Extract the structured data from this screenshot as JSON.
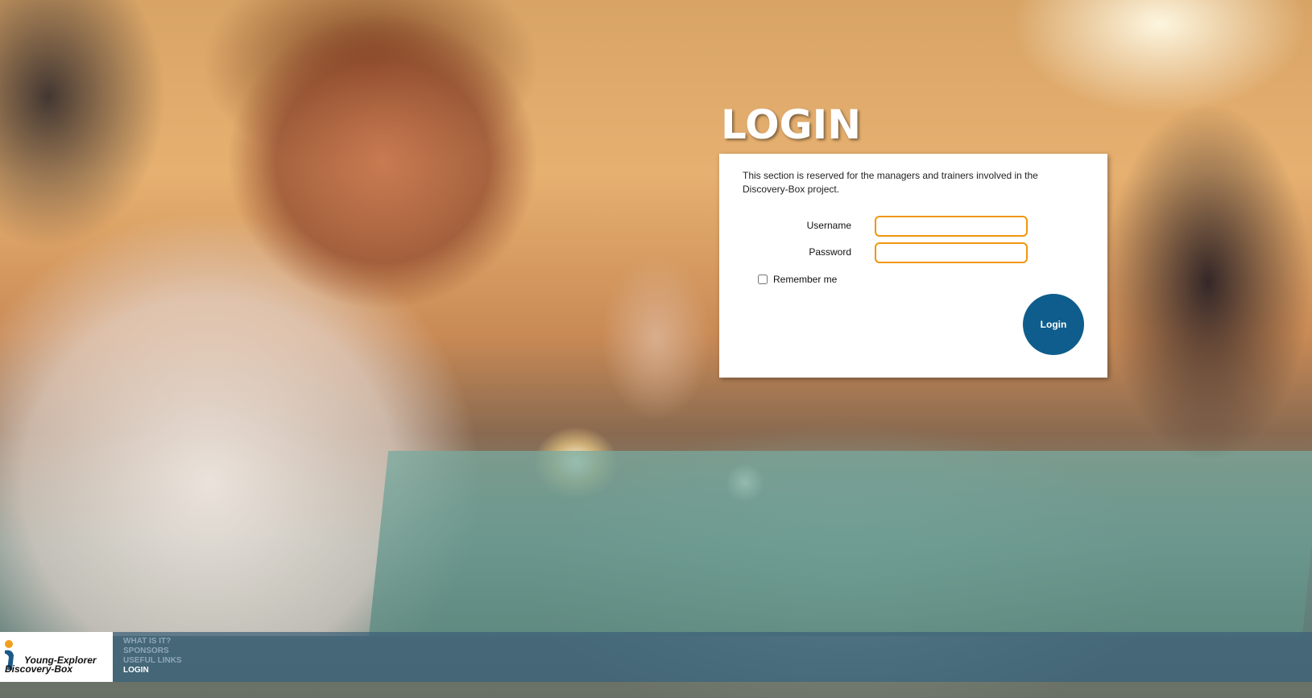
{
  "login": {
    "title": "LOGIN",
    "intro": "This section is reserved for the managers and trainers involved in the Discovery-Box project.",
    "username_label": "Username",
    "username_value": "",
    "password_label": "Password",
    "password_value": "",
    "remember_label": "Remember me",
    "remember_checked": false,
    "button_label": "Login"
  },
  "footer": {
    "logo_line1": "Young-Explorer",
    "logo_line2": "Discovery-Box",
    "nav": [
      {
        "label": "WHAT IS IT?",
        "active": false
      },
      {
        "label": "SPONSORS",
        "active": false
      },
      {
        "label": "USEFUL LINKS",
        "active": false
      },
      {
        "label": "LOGIN",
        "active": true
      }
    ]
  },
  "colors": {
    "input_border": "#f0960e",
    "button_bg": "#0f5d8c",
    "footer_bg": "#3c5f78"
  }
}
